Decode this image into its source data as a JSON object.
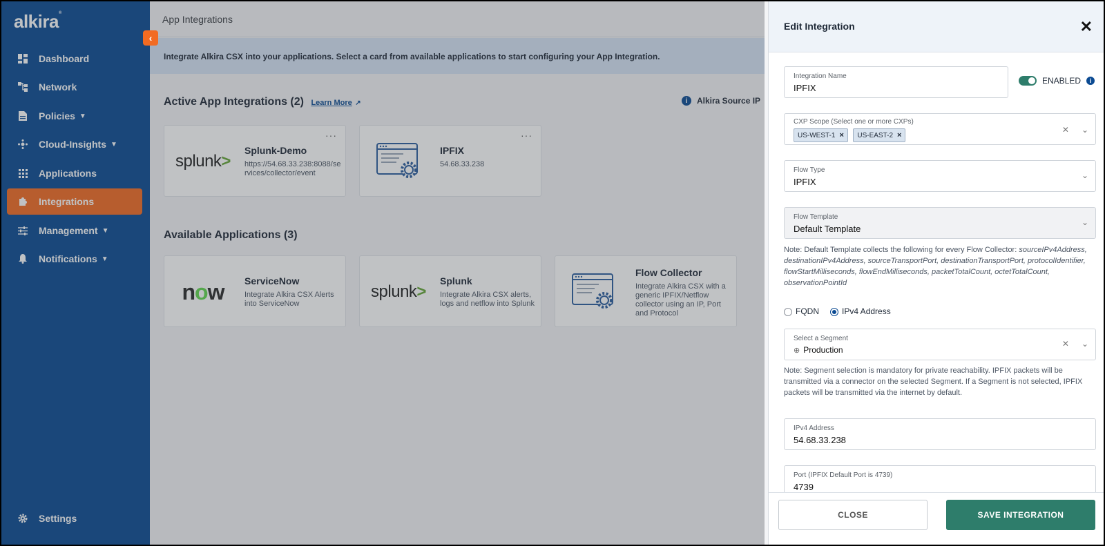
{
  "brand": {
    "logo": "alkira",
    "accent": "#f26b22",
    "sidebar_bg": "#0b4a92",
    "save_color": "#2e7d6b"
  },
  "sidebar": {
    "items": [
      {
        "label": "Dashboard",
        "icon": "dashboard-icon"
      },
      {
        "label": "Network",
        "icon": "network-icon"
      },
      {
        "label": "Policies",
        "icon": "policies-icon",
        "has_chevron": true
      },
      {
        "label": "Cloud-Insights",
        "icon": "cloud-insights-icon",
        "has_chevron": true
      },
      {
        "label": "Applications",
        "icon": "applications-icon"
      },
      {
        "label": "Integrations",
        "icon": "integrations-icon",
        "active": true
      },
      {
        "label": "Management",
        "icon": "management-icon",
        "has_chevron": true
      },
      {
        "label": "Notifications",
        "icon": "bell-icon",
        "has_chevron": true
      }
    ],
    "settings_label": "Settings"
  },
  "main": {
    "page_title": "App Integrations",
    "banner": "Integrate Alkira CSX into your applications. Select a card from available applications to start configuring your App Integration.",
    "active_title": "Active App Integrations (2)",
    "learn_more": "Learn More",
    "source_label": "Alkira Source IP",
    "active_cards": [
      {
        "title": "Splunk-Demo",
        "desc": "https://54.68.33.238:8088/services/collector/event",
        "logo": "splunk"
      },
      {
        "title": "IPFIX",
        "desc": "54.68.33.238",
        "logo": "flow-collector"
      }
    ],
    "available_title": "Available Applications (3)",
    "available_cards": [
      {
        "title": "ServiceNow",
        "desc": "Integrate Alkira CSX Alerts into ServiceNow",
        "logo": "now"
      },
      {
        "title": "Splunk",
        "desc": "Integrate Alkira CSX alerts, logs and netflow into Splunk",
        "logo": "splunk"
      },
      {
        "title": "Flow Collector",
        "desc": "Integrate Alkira CSX with a generic IPFIX/Netflow collector using an IP, Port and Protocol",
        "logo": "flow-collector"
      }
    ]
  },
  "panel": {
    "title": "Edit Integration",
    "integration_name_label": "Integration Name",
    "integration_name_value": "IPFIX",
    "enabled_label": "ENABLED",
    "cxp_label": "CXP Scope (Select one or more CXPs)",
    "cxp_chips": [
      "US-WEST-1",
      "US-EAST-2"
    ],
    "flow_type_label": "Flow Type",
    "flow_type_value": "IPFIX",
    "flow_template_label": "Flow Template",
    "flow_template_value": "Default Template",
    "template_note_prefix": "Note: Default Template collects the following for every Flow Collector: ",
    "template_note_fields": "sourceIPv4Address, destinationIPv4Address, sourceTransportPort, destinationTransportPort, protocolIdentifier, flowStartMilliseconds, flowEndMilliseconds, packetTotalCount, octetTotalCount, observationPointId",
    "radio_fqdn": "FQDN",
    "radio_ipv4": "IPv4 Address",
    "segment_label": "Select a Segment",
    "segment_value": "Production",
    "segment_note": "Note: Segment selection is mandatory for private reachability. IPFIX packets will be transmitted via a connector on the selected Segment. If a Segment is not selected, IPFIX packets will be transmitted via the internet by default.",
    "ipv4_label": "IPv4 Address",
    "ipv4_value": "54.68.33.238",
    "port_label": "Port (IPFIX Default Port is 4739)",
    "port_value": "4739",
    "close_button": "CLOSE",
    "save_button": "SAVE INTEGRATION"
  }
}
